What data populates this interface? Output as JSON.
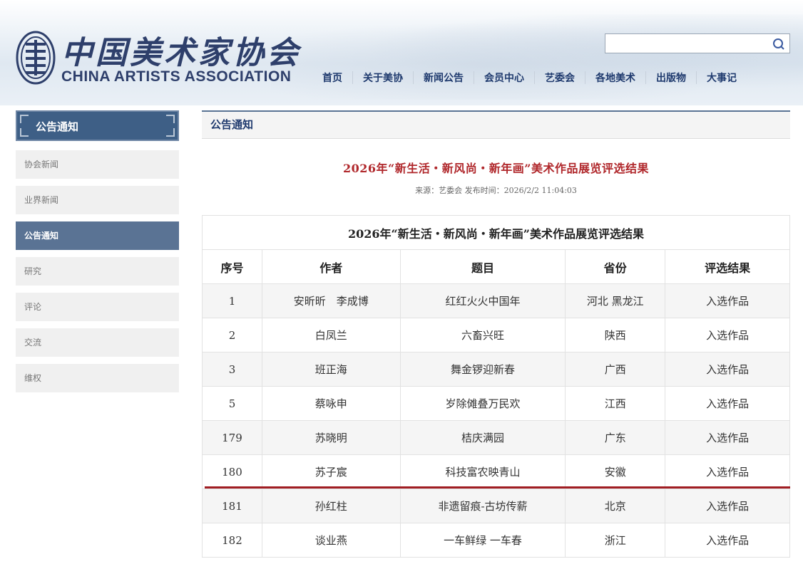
{
  "header": {
    "logo_cn": "中国美术家协会",
    "logo_en": "CHINA ARTISTS ASSOCIATION",
    "search": {
      "value": "",
      "placeholder": ""
    }
  },
  "nav": {
    "items": [
      "首页",
      "关于美协",
      "新闻公告",
      "会员中心",
      "艺委会",
      "各地美术",
      "出版物",
      "大事记"
    ]
  },
  "sidebar": {
    "title": "公告通知",
    "items": [
      {
        "label": "协会新闻",
        "active": false
      },
      {
        "label": "业界新闻",
        "active": false
      },
      {
        "label": "公告通知",
        "active": true
      },
      {
        "label": "研究",
        "active": false
      },
      {
        "label": "评论",
        "active": false
      },
      {
        "label": "交流",
        "active": false
      },
      {
        "label": "维权",
        "active": false
      }
    ]
  },
  "main": {
    "section_title": "公告通知",
    "article_title": "2026年“新生活・新风尚・新年画”美术作品展览评选结果",
    "article_meta": "来源：艺委会 发布时间：2026/2/2 11:04:03",
    "table": {
      "caption": "2026年“新生活・新风尚・新年画”美术作品展览评选结果",
      "headers": [
        "序号",
        "作者",
        "题目",
        "省份",
        "评选结果"
      ],
      "rows": [
        [
          "1",
          "安昕昕　李成博",
          "红红火火中国年",
          "河北 黑龙江",
          "入选作品"
        ],
        [
          "2",
          "白凤兰",
          "六畜兴旺",
          "陕西",
          "入选作品"
        ],
        [
          "3",
          "班正海",
          "舞金锣迎新春",
          "广西",
          "入选作品"
        ],
        [
          "5",
          "蔡咏申",
          "岁除傩叠万民欢",
          "江西",
          "入选作品"
        ],
        [
          "179",
          "苏晓明",
          "桔庆满园",
          "广东",
          "入选作品"
        ],
        [
          "180",
          "苏子宸",
          "科技富农映青山",
          "安徽",
          "入选作品"
        ],
        [
          "181",
          "孙红柱",
          "非遗留痕-古坊传薪",
          "北京",
          "入选作品"
        ],
        [
          "182",
          "谈业燕",
          "一车鲜绿 一车春",
          "浙江",
          "入选作品"
        ]
      ]
    }
  },
  "colors": {
    "brand_blue": "#2e3f6b",
    "sidebar_active": "#5a7394",
    "title_red": "#b0272b",
    "divider_red": "#a01d22"
  }
}
